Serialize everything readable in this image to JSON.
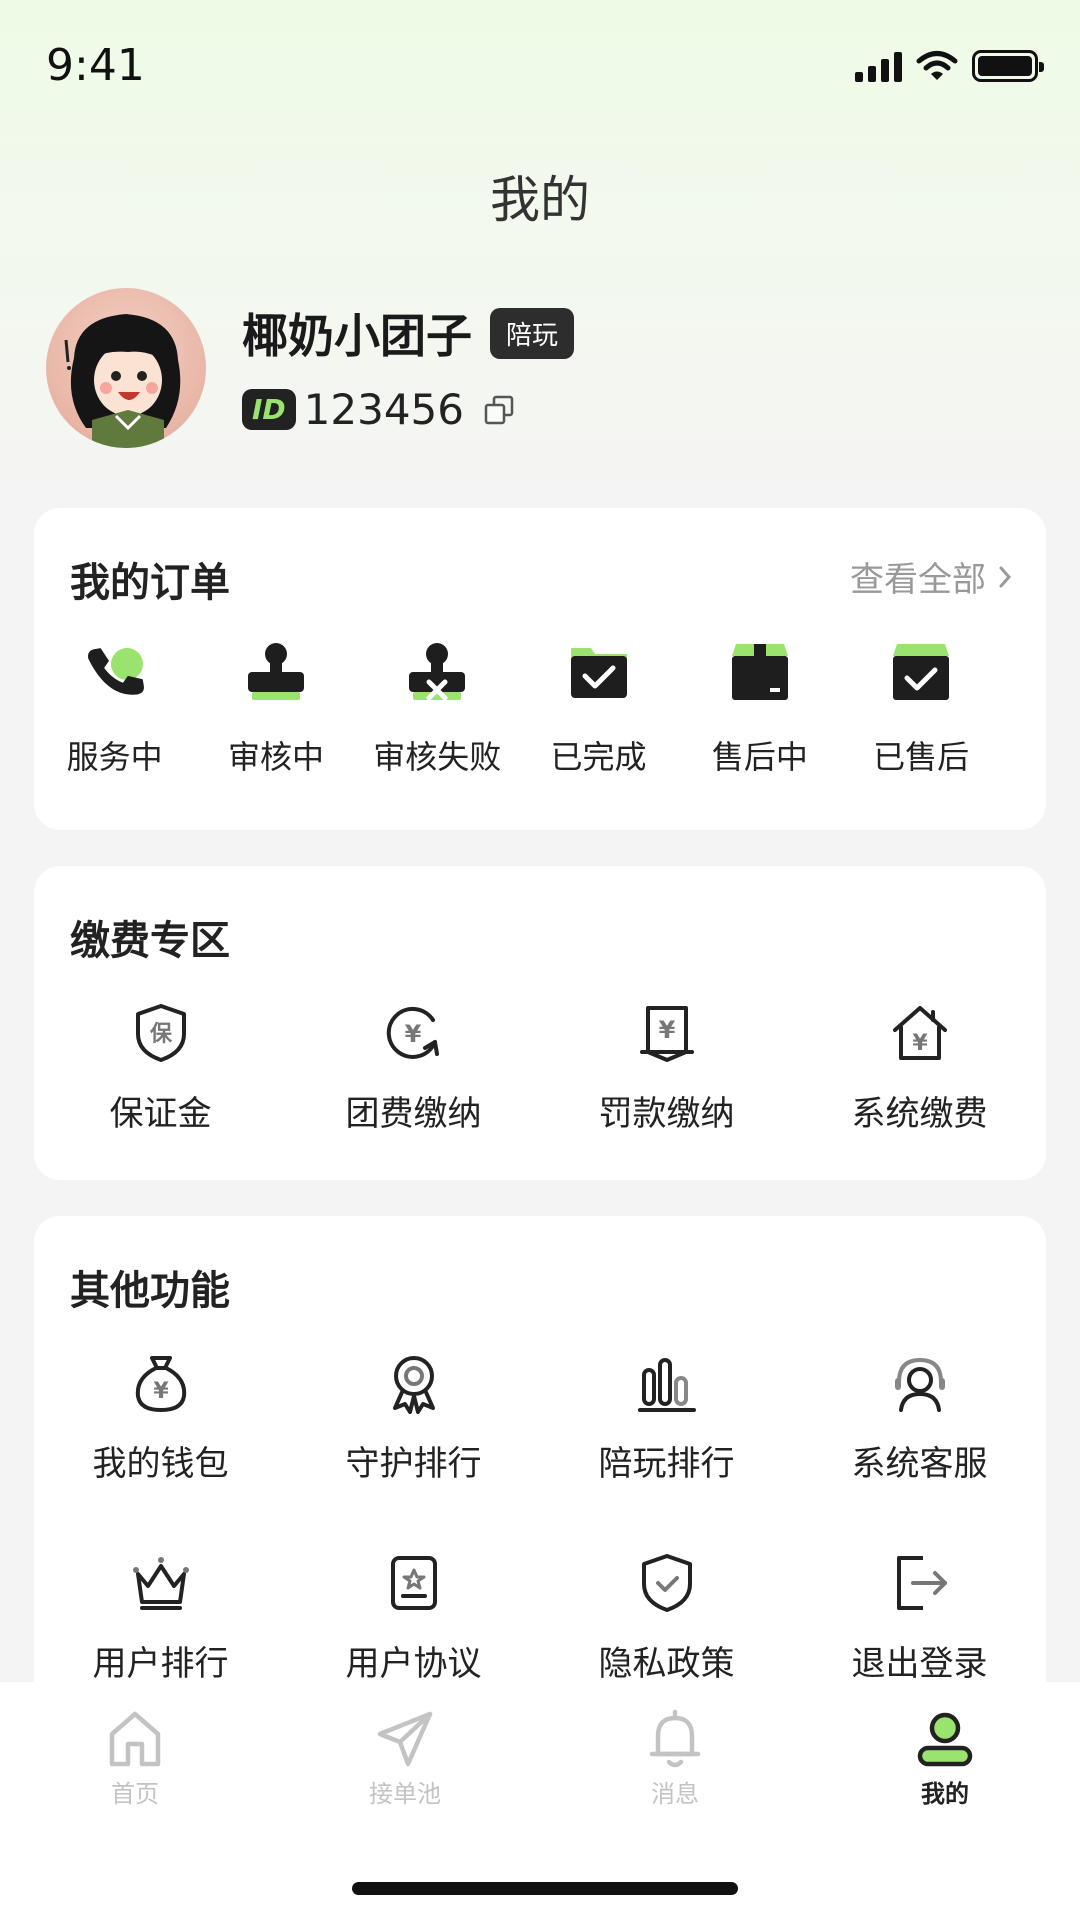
{
  "status_bar": {
    "time": "9:41"
  },
  "page": {
    "title": "我的"
  },
  "profile": {
    "name": "椰奶小团子",
    "role_badge": "陪玩",
    "id_label": "ID",
    "id_value": "123456"
  },
  "orders": {
    "title": "我的订单",
    "view_all": "查看全部",
    "items": [
      {
        "label": "服务中",
        "icon": "phone-icon"
      },
      {
        "label": "审核中",
        "icon": "stamp-icon"
      },
      {
        "label": "审核失败",
        "icon": "stamp-fail-icon"
      },
      {
        "label": "已完成",
        "icon": "folder-check-icon"
      },
      {
        "label": "售后中",
        "icon": "box-icon"
      },
      {
        "label": "已售后",
        "icon": "box-check-icon"
      }
    ]
  },
  "payment": {
    "title": "缴费专区",
    "items": [
      {
        "label": "保证金",
        "icon": "shield-guarantee-icon"
      },
      {
        "label": "团费缴纳",
        "icon": "yen-circle-icon"
      },
      {
        "label": "罚款缴纳",
        "icon": "yen-doc-icon"
      },
      {
        "label": "系统缴费",
        "icon": "yen-house-icon"
      }
    ]
  },
  "other": {
    "title": "其他功能",
    "items": [
      {
        "label": "我的钱包",
        "icon": "money-bag-icon"
      },
      {
        "label": "守护排行",
        "icon": "medal-icon"
      },
      {
        "label": "陪玩排行",
        "icon": "bar-chart-icon"
      },
      {
        "label": "系统客服",
        "icon": "headset-icon"
      },
      {
        "label": "用户排行",
        "icon": "crown-icon"
      },
      {
        "label": "用户协议",
        "icon": "agreement-icon"
      },
      {
        "label": "隐私政策",
        "icon": "shield-check-icon"
      },
      {
        "label": "退出登录",
        "icon": "logout-icon"
      }
    ]
  },
  "tabbar": {
    "items": [
      {
        "label": "首页",
        "icon": "home-icon"
      },
      {
        "label": "接单池",
        "icon": "send-icon"
      },
      {
        "label": "消息",
        "icon": "bell-icon"
      },
      {
        "label": "我的",
        "icon": "user-icon",
        "active": true
      }
    ]
  },
  "colors": {
    "accent": "#9be36f",
    "dark": "#222222",
    "inactive": "#c3c3c3"
  }
}
